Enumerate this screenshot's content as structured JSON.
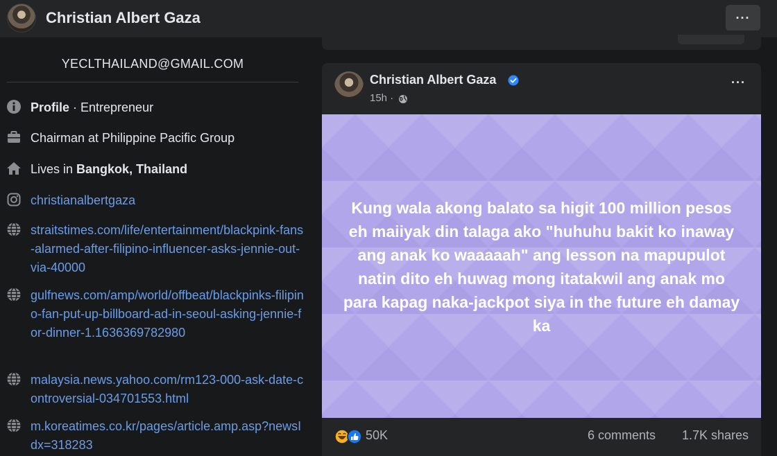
{
  "header": {
    "profile_name": "Christian Albert Gaza",
    "more_label": "···"
  },
  "intro": {
    "email": "YECLTHAILAND@GMAIL.COM",
    "profile_type_bold": "Profile",
    "profile_type_rest": " · Entrepreneur",
    "work": "Chairman at Philippine Pacific Group",
    "lives_prefix": "Lives in ",
    "lives_location": "Bangkok, Thailand",
    "instagram": "christianalbertgaza",
    "links": [
      "straitstimes.com/life/entertainment/blackpink-fans-alarmed-after-filipino-influencer-asks-jennie-out-via-40000",
      "gulfnews.com/amp/world/offbeat/blackpinks-filipino-fan-put-up-billboard-ad-in-seoul-asking-jennie-for-dinner-1.1636369782980",
      "malaysia.news.yahoo.com/rm123-000-ask-date-controversial-034701553.html",
      "m.koreatimes.co.kr/pages/article.amp.asp?newsIdx=318283"
    ]
  },
  "post": {
    "author": "Christian Albert Gaza",
    "time": "15h ·",
    "more_label": "···",
    "status_text": "Kung wala akong balato sa higit 100 million pesos eh maiiyak din talaga ako \"huhuhu bakit ko inaway ang anak ko waaaaah\" ang lesson na mapupulot natin dito eh huwag mong itatakwil ang anak mo para kapag naka-jackpot siya in the future eh damay ka",
    "reaction_count": "50K",
    "comments": "6 comments",
    "shares": "1.7K shares"
  },
  "colors": {
    "background": "#18191a",
    "card": "#242526",
    "link": "#6b9ce8",
    "status_bg": "#b1a6e9",
    "verified": "#2d88ff"
  }
}
